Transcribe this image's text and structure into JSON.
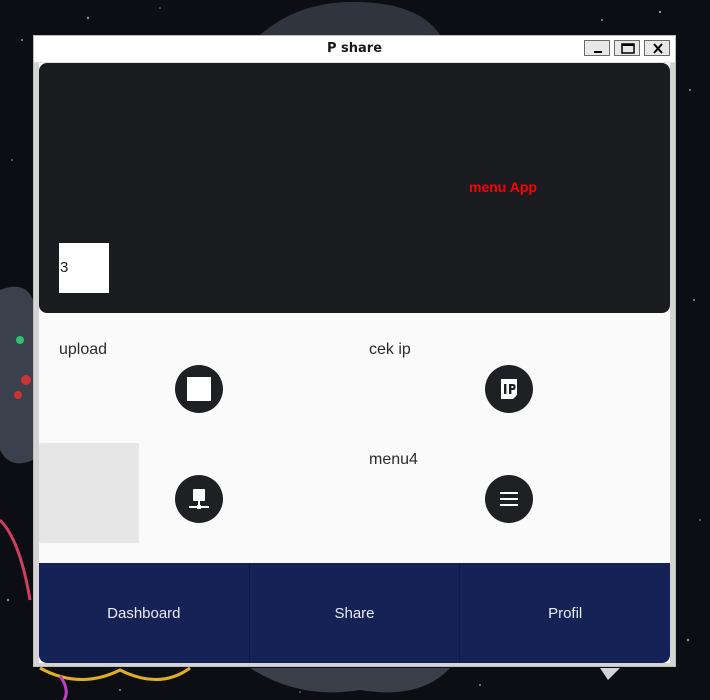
{
  "window": {
    "title": "P share"
  },
  "hero": {
    "title": "menu App",
    "title_color": "#ff0000",
    "counter_value": "3"
  },
  "menu": {
    "items": [
      {
        "label": "upload",
        "icon": "stop-square-icon"
      },
      {
        "label": "cek ip",
        "icon": "ip-icon"
      },
      {
        "label": "",
        "icon": "network-icon"
      },
      {
        "label": "menu4",
        "icon": "hamburger-menu-icon"
      }
    ]
  },
  "bottom_nav": {
    "items": [
      {
        "label": "Dashboard"
      },
      {
        "label": "Share"
      },
      {
        "label": "Profil"
      }
    ]
  },
  "colors": {
    "panel": "#1b1c20",
    "nav": "#152255",
    "circle_button": "#1f2024",
    "background": "#fafafa"
  }
}
